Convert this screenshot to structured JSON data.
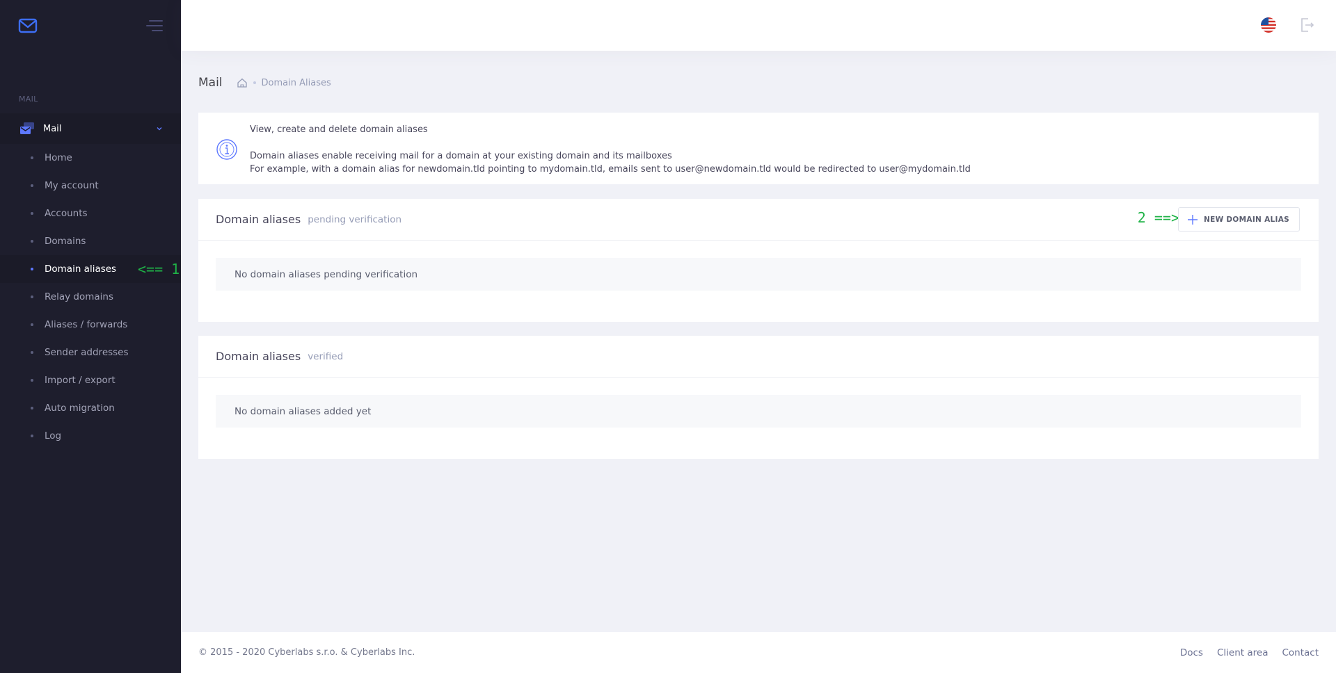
{
  "sidebar": {
    "section_title": "MAIL",
    "menu_head": "Mail",
    "items": [
      {
        "label": "Home"
      },
      {
        "label": "My account"
      },
      {
        "label": "Accounts"
      },
      {
        "label": "Domains"
      },
      {
        "label": "Domain aliases",
        "active": true
      },
      {
        "label": "Relay domains"
      },
      {
        "label": "Aliases / forwards"
      },
      {
        "label": "Sender addresses"
      },
      {
        "label": "Import / export"
      },
      {
        "label": "Auto migration"
      },
      {
        "label": "Log"
      }
    ],
    "annotation": "<== 1"
  },
  "header": {
    "language_icon": "us-flag-icon",
    "logout_icon": "logout-icon"
  },
  "subheader": {
    "title": "Mail",
    "breadcrumb": "Domain Aliases"
  },
  "info": {
    "line1": "View, create and delete domain aliases",
    "line2": "Domain aliases enable receiving mail for a domain at your existing domain and its mailboxes",
    "line3": "For example, with a domain alias for newdomain.tld pointing to mydomain.tld, emails sent to user@newdomain.tld would be redirected to user@mydomain.tld"
  },
  "pending": {
    "title": "Domain aliases",
    "subtitle": "pending verification",
    "button_label": "NEW DOMAIN ALIAS",
    "annotation": "2 ==>",
    "empty": "No domain aliases pending verification"
  },
  "verified": {
    "title": "Domain aliases",
    "subtitle": "verified",
    "empty": "No domain aliases added yet"
  },
  "footer": {
    "copyright": "© 2015 - 2020 Cyberlabs s.r.o. & Cyberlabs Inc.",
    "links": [
      "Docs",
      "Client area",
      "Contact"
    ]
  },
  "colors": {
    "sidebar_bg": "#1e1e2d",
    "accent": "#5d78ff",
    "annotation": "#1fb347"
  }
}
